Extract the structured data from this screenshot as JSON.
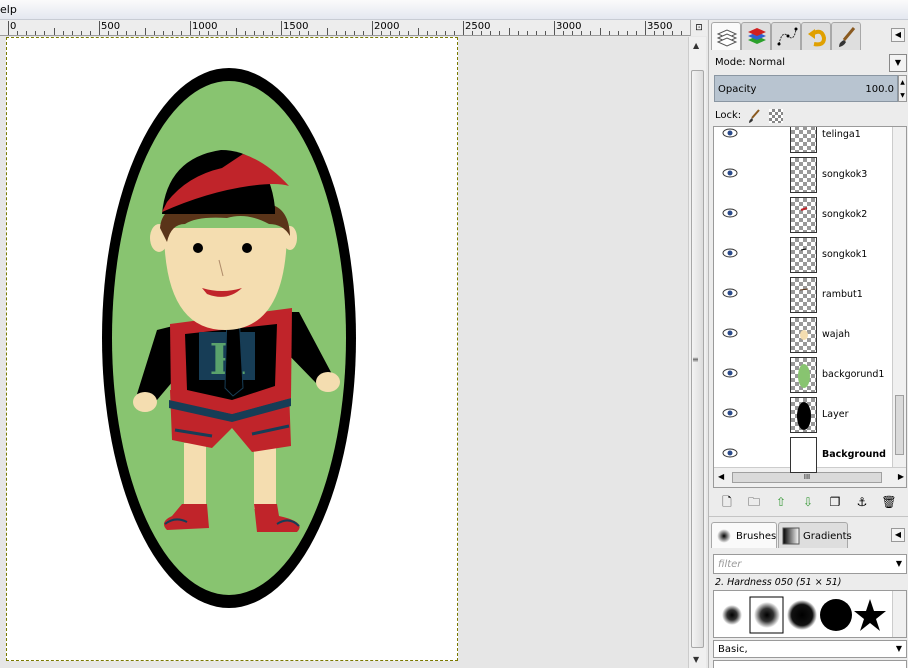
{
  "menubar": {
    "partial_label": "elp"
  },
  "ruler": {
    "labels": [
      "0",
      "500",
      "1000",
      "1500",
      "2000",
      "2500",
      "3000",
      "3500"
    ]
  },
  "layers_panel": {
    "mode_label": "Mode: Normal",
    "opacity_label": "Opacity",
    "opacity_value": "100.0",
    "lock_label": "Lock:",
    "layers": [
      {
        "name": "telinga1",
        "visible": true,
        "bold": false
      },
      {
        "name": "songkok3",
        "visible": true,
        "bold": false
      },
      {
        "name": "songkok2",
        "visible": true,
        "bold": false
      },
      {
        "name": "songkok1",
        "visible": true,
        "bold": false
      },
      {
        "name": "rambut1",
        "visible": true,
        "bold": false
      },
      {
        "name": "wajah",
        "visible": true,
        "bold": false
      },
      {
        "name": "backgorund1",
        "visible": true,
        "bold": false
      },
      {
        "name": "Layer",
        "visible": true,
        "bold": false
      },
      {
        "name": "Background",
        "visible": true,
        "bold": true
      }
    ],
    "hscroll_grip": "III"
  },
  "brushes_panel": {
    "tab_brushes": "Brushes",
    "tab_gradients": "Gradients",
    "filter_placeholder": "filter",
    "selected_brush": "2. Hardness 050 (51 × 51)",
    "preset": "Basic,"
  },
  "icons": {
    "dock_tabs": [
      "layers-icon",
      "channels-icon",
      "paths-icon",
      "undo-history-icon",
      "brush-tool-icon"
    ],
    "layer_buttons": [
      "new-layer-icon",
      "open-folder-icon",
      "raise-layer-icon",
      "lower-layer-icon",
      "duplicate-layer-icon",
      "anchor-icon",
      "delete-layer-icon"
    ]
  },
  "colors": {
    "ellipse_green": "#88c470",
    "ellipse_border": "#000000",
    "shirt_black": "#000000",
    "shirt_red": "#c0242a",
    "letter_panel": "#173d56",
    "letter_green": "#5aa26c",
    "skin": "#f4ddb0",
    "hair": "#5a3419",
    "opacity_bar": "#b8c4d0"
  },
  "artwork": {
    "shirt_letter": "R"
  }
}
